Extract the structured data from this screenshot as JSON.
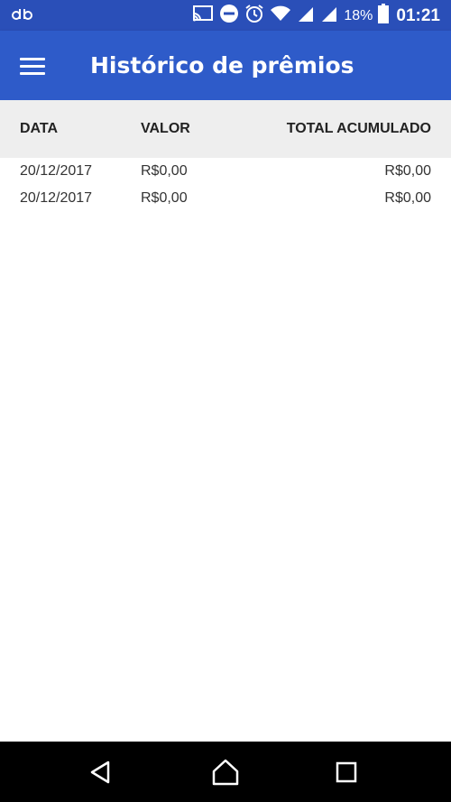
{
  "status_bar": {
    "battery_percent": "18%",
    "time": "01:21"
  },
  "app_bar": {
    "title": "Histórico de prêmios"
  },
  "table": {
    "headers": {
      "date": "DATA",
      "value": "VALOR",
      "total": "TOTAL ACUMULADO"
    },
    "rows": [
      {
        "date": "20/12/2017",
        "value": "R$0,00",
        "total": "R$0,00"
      },
      {
        "date": "20/12/2017",
        "value": "R$0,00",
        "total": "R$0,00"
      }
    ]
  },
  "colors": {
    "status_bar": "#2a4fb8",
    "app_bar": "#2e5bc9",
    "table_header_bg": "#eeeeee",
    "nav_bar": "#000000"
  },
  "icons": {
    "status_left": "app-notification-icon",
    "status_right": [
      "cast-icon",
      "do-not-disturb-icon",
      "alarm-icon",
      "wifi-icon",
      "signal-icon",
      "signal-icon",
      "battery-icon"
    ],
    "nav": [
      "back-icon",
      "home-icon",
      "recent-apps-icon"
    ]
  }
}
